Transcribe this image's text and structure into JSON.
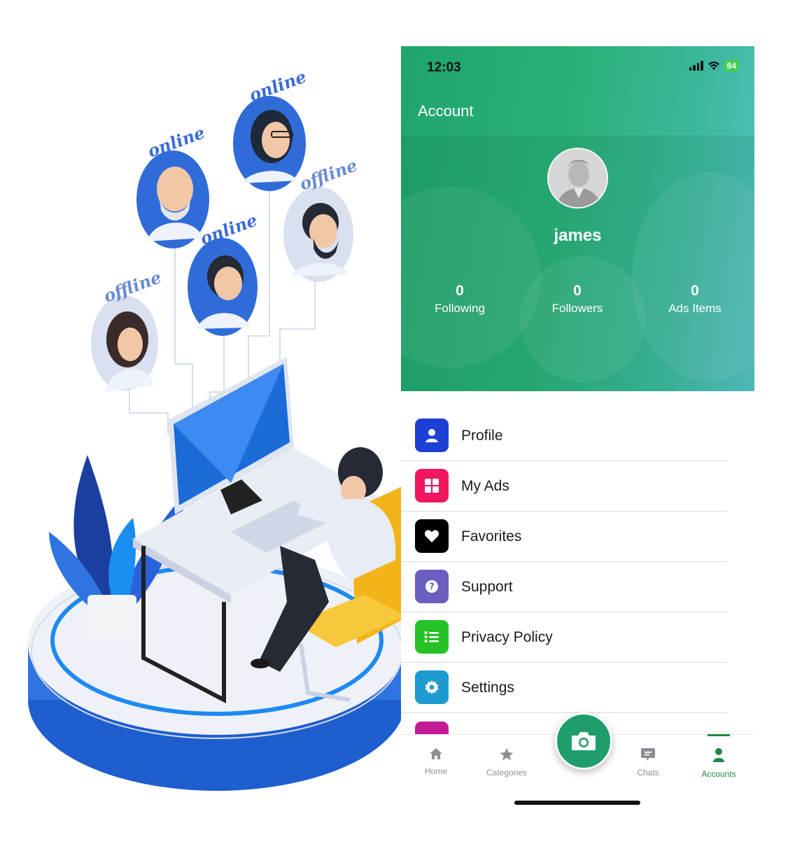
{
  "illustration": {
    "tags": [
      "online",
      "online",
      "online",
      "offline",
      "offline"
    ]
  },
  "status_bar": {
    "time": "12:03",
    "battery": "84"
  },
  "header": {
    "title": "Account"
  },
  "profile": {
    "username": "james",
    "stats": [
      {
        "value": "0",
        "label": "Following"
      },
      {
        "value": "0",
        "label": "Followers"
      },
      {
        "value": "0",
        "label": "Ads Items"
      }
    ]
  },
  "menu": {
    "items": [
      {
        "label": "Profile",
        "icon": "person-icon",
        "color": "#1e3fd6"
      },
      {
        "label": "My Ads",
        "icon": "grid-icon",
        "color": "#f0175e"
      },
      {
        "label": "Favorites",
        "icon": "heart-icon",
        "color": "#000000"
      },
      {
        "label": "Support",
        "icon": "question-icon",
        "color": "#6a5fc1"
      },
      {
        "label": "Privacy Policy",
        "icon": "list-icon",
        "color": "#27c228"
      },
      {
        "label": "Settings",
        "icon": "gear-icon",
        "color": "#1d9bd1"
      }
    ]
  },
  "bottom_nav": {
    "items": [
      {
        "label": "Home",
        "icon": "home-icon"
      },
      {
        "label": "Categories",
        "icon": "star-icon"
      },
      {
        "label": "Chats",
        "icon": "chat-icon"
      },
      {
        "label": "Accounts",
        "icon": "person-icon",
        "active": true
      }
    ],
    "center_icon": "camera-icon",
    "accent": "#1b8a45"
  }
}
